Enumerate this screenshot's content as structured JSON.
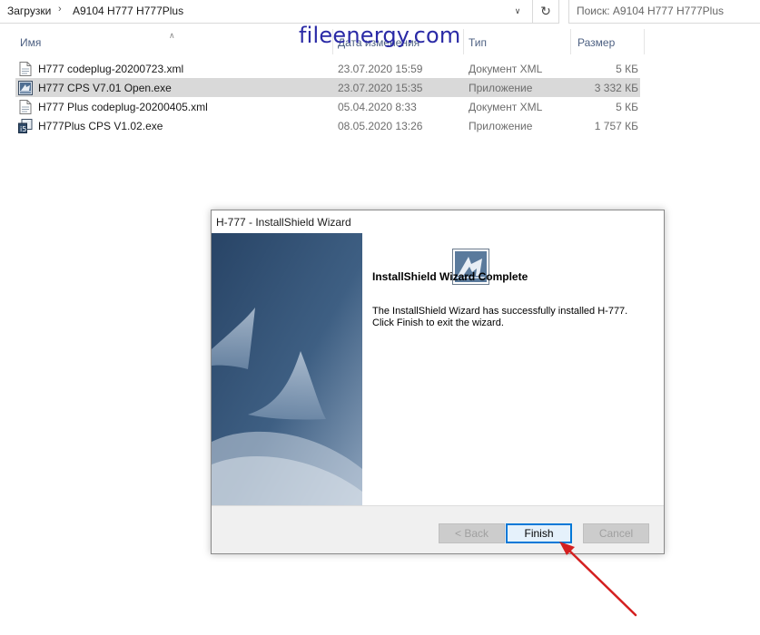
{
  "explorer": {
    "breadcrumb": [
      "Загрузки",
      "A9104 H777 H777Plus"
    ],
    "search_placeholder": "Поиск: A9104 H777 H777Plus",
    "columns": {
      "name": "Имя",
      "date": "Дата изменения",
      "type": "Тип",
      "size": "Размер"
    },
    "files": [
      {
        "name": "H777 codeplug-20200723.xml",
        "date": "23.07.2020 15:59",
        "type": "Документ XML",
        "size": "5 КБ",
        "icon": "xml-file-icon"
      },
      {
        "name": "H777 CPS V7.01 Open.exe",
        "date": "23.07.2020 15:35",
        "type": "Приложение",
        "size": "3 332 КБ",
        "icon": "installer-app-icon",
        "selected": true
      },
      {
        "name": "H777 Plus codeplug-20200405.xml",
        "date": "05.04.2020 8:33",
        "type": "Документ XML",
        "size": "5 КБ",
        "icon": "xml-file-icon"
      },
      {
        "name": "H777Plus CPS V1.02.exe",
        "date": "08.05.2020 13:26",
        "type": "Приложение",
        "size": "1 757 КБ",
        "icon": "setup-app-icon"
      }
    ]
  },
  "watermark": "fileenergy.com",
  "dialog": {
    "title": "H-777 - InstallShield Wizard",
    "heading": "InstallShield Wizard Complete",
    "message_line1": "The InstallShield Wizard has successfully installed H-777.",
    "message_line2": "Click Finish to exit the wizard.",
    "buttons": {
      "back": "< Back",
      "finish": "Finish",
      "cancel": "Cancel"
    },
    "back_enabled": false,
    "cancel_enabled": false,
    "default_button": "finish"
  },
  "colors": {
    "selection": "#d9d9d9",
    "header_text": "#4d6082",
    "banner_dark": "#2c4a6e",
    "banner_light": "#b8c6d6",
    "default_button_border": "#0078d7",
    "annotation_arrow": "#d42020"
  }
}
